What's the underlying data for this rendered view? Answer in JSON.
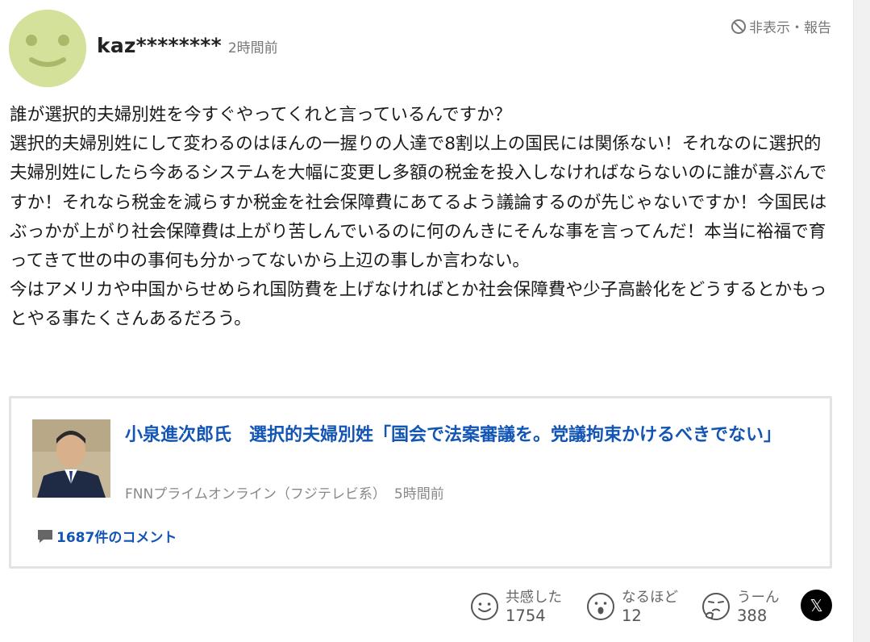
{
  "comment": {
    "username": "kaz********",
    "timestamp": "2時間前",
    "report_label": "非表示・報告",
    "body": "誰が選択的夫婦別姓を今すぐやってくれと言っているんですか？\n選択的夫婦別姓にして変わるのはほんの一握りの人達で8割以上の国民には関係ない！それなのに選択的夫婦別姓にしたら今あるシステムを大幅に変更し多額の税金を投入しなければならないのに誰が喜ぶんですか！それなら税金を減らすか税金を社会保障費にあてるよう議論するのが先じゃないですか！今国民はぶっかが上がり社会保障費は上がり苦しんでいるのに何のんきにそんな事を言ってんだ！本当に裕福で育ってきて世の中の事何も分かってないから上辺の事しか言わない。\n今はアメリカや中国からせめられ国防費を上げなければとか社会保障費や少子高齢化をどうするとかもっとやる事たくさんあるだろう。",
    "avatar_color": "#d3e19b"
  },
  "article": {
    "title": "小泉進次郎氏　選択的夫婦別姓「国会で法案審議を。党議拘束かけるべきでない」",
    "source": "FNNプライムオンライン（フジテレビ系）",
    "time": "5時間前",
    "comment_count": "1687件のコメント",
    "link_color": "#1255b4"
  },
  "reactions": [
    {
      "label": "共感した",
      "count": "1754",
      "icon": "smile-face-icon"
    },
    {
      "label": "なるほど",
      "count": "12",
      "icon": "surprised-face-icon"
    },
    {
      "label": "うーん",
      "count": "388",
      "icon": "thinking-face-icon"
    }
  ],
  "share": {
    "glyph": "𝕏",
    "icon": "x-logo-icon"
  }
}
